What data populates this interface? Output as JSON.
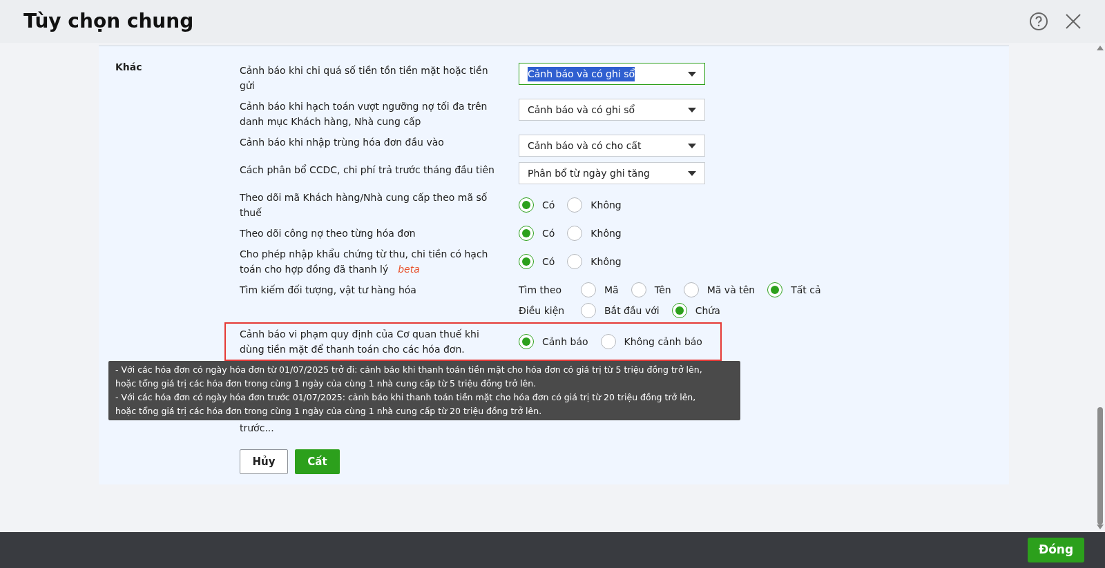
{
  "window": {
    "title": "Tùy chọn chung"
  },
  "section": {
    "title": "Khác",
    "options": [
      {
        "kind": "select",
        "label": "Cảnh báo khi chi quá số tiền tồn tiền mặt hoặc tiền gửi",
        "value": "Cảnh báo và có ghi sổ",
        "focused": true
      },
      {
        "kind": "select",
        "label": "Cảnh báo khi hạch toán vượt ngưỡng nợ tối đa trên danh mục Khách hàng, Nhà cung cấp",
        "value": "Cảnh báo và có ghi sổ",
        "focused": false
      },
      {
        "kind": "select",
        "label": "Cảnh báo khi nhập trùng hóa đơn đầu vào",
        "value": "Cảnh báo và có cho cất",
        "focused": false
      },
      {
        "kind": "select",
        "label": "Cách phân bổ CCDC, chi phí trả trước tháng đầu tiên",
        "value": "Phân bổ từ ngày ghi tăng",
        "focused": false
      },
      {
        "kind": "radio",
        "label": "Theo dõi mã Khách hàng/Nhà cung cấp theo mã số thuế",
        "choices": [
          {
            "label": "Có",
            "selected": true
          },
          {
            "label": "Không",
            "selected": false
          }
        ]
      },
      {
        "kind": "radio",
        "label": "Theo dõi công nợ theo từng hóa đơn",
        "choices": [
          {
            "label": "Có",
            "selected": true
          },
          {
            "label": "Không",
            "selected": false
          }
        ]
      },
      {
        "kind": "radio",
        "label": "Cho phép nhập khẩu chứng từ thu, chi tiền có hạch toán cho hợp đồng đã thanh lý",
        "badge": "beta",
        "choices": [
          {
            "label": "Có",
            "selected": true
          },
          {
            "label": "Không",
            "selected": false
          }
        ]
      },
      {
        "kind": "radio_groups",
        "label": "Tìm kiếm đối tượng, vật tư hàng hóa",
        "groups": [
          {
            "label": "Tìm theo",
            "choices": [
              {
                "label": "Mã",
                "selected": false
              },
              {
                "label": "Tên",
                "selected": false
              },
              {
                "label": "Mã và tên",
                "selected": false
              },
              {
                "label": "Tất cả",
                "selected": true
              }
            ]
          },
          {
            "label": "Điều kiện",
            "choices": [
              {
                "label": "Bắt đầu với",
                "selected": false
              },
              {
                "label": "Chứa",
                "selected": true
              }
            ]
          }
        ]
      },
      {
        "kind": "radio",
        "label": "Cảnh báo vi phạm quy định của Cơ quan thuế khi dùng tiền mặt để thanh toán cho các hóa đơn.",
        "highlighted": true,
        "tooltip": [
          "- Với các hóa đơn có ngày hóa đơn từ 01/07/2025 trở đi: cảnh báo khi thanh toán tiền mặt cho hóa đơn có giá trị từ 5 triệu đồng trở lên,",
          "hoặc tổng giá trị các hóa đơn trong cùng 1 ngày của cùng 1 nhà cung cấp từ 5 triệu đồng trở lên.",
          "- Với các hóa đơn có ngày hóa đơn trước 01/07/2025: cảnh báo khi thanh toán tiền mặt cho hóa đơn có giá trị từ 20 triệu đồng trở lên,",
          "hoặc tổng giá trị các hóa đơn trong cùng 1 ngày của cùng 1 nhà cung cấp từ 20 triệu đồng trở lên."
        ],
        "choices": [
          {
            "label": "Cảnh báo",
            "selected": true
          },
          {
            "label": "Không cảnh báo",
            "selected": false
          }
        ]
      }
    ],
    "partial_row": {
      "label": "trước..."
    }
  },
  "actions": {
    "cancel": "Hủy",
    "save": "Cất"
  },
  "footer": {
    "close": "Đóng"
  }
}
